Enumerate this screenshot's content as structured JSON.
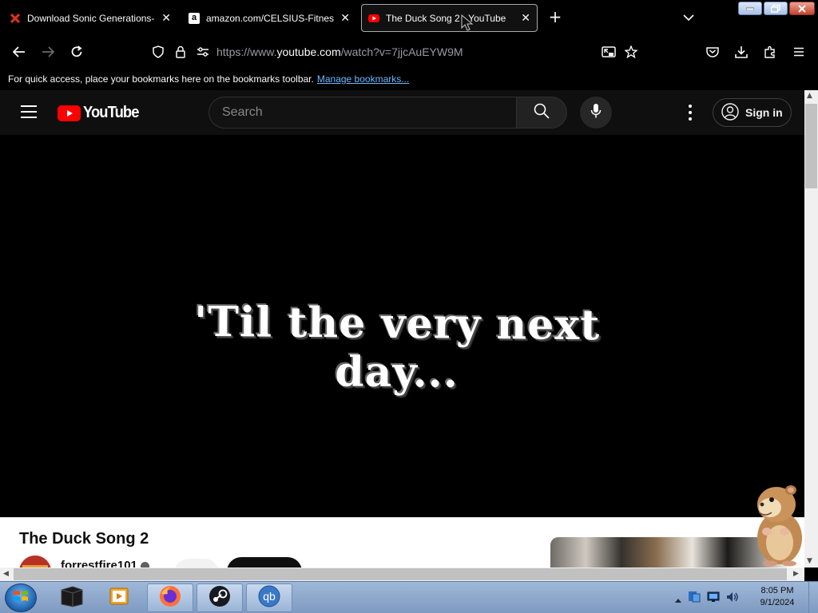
{
  "browser": {
    "tabs": [
      {
        "title": "Download Sonic Generations-Fi",
        "icon": "x-favicon",
        "active": false
      },
      {
        "title": "amazon.com/CELSIUS-Fitness-",
        "icon": "amazon-favicon",
        "active": false
      },
      {
        "title": "The Duck Song 2 - YouTube",
        "icon": "youtube-favicon",
        "active": true
      }
    ],
    "url_prefix": "https://www.",
    "url_domain": "youtube.com",
    "url_suffix": "/watch?v=7jjcAuEYW9M",
    "bookmarks_text": "For quick access, place your bookmarks here on the bookmarks toolbar.",
    "bookmarks_link": "Manage bookmarks..."
  },
  "youtube": {
    "logo_text": "YouTube",
    "search_placeholder": "Search",
    "sign_in": "Sign in",
    "video_caption": "'Til the very next day...",
    "video_title": "The Duck Song 2",
    "channel_name": "forrestfire101"
  },
  "taskbar": {
    "time": "8:05 PM",
    "date": "9/1/2024"
  },
  "colors": {
    "youtube_red": "#ff0000",
    "link_blue": "#6db7ff",
    "page_bg": "#000000"
  }
}
